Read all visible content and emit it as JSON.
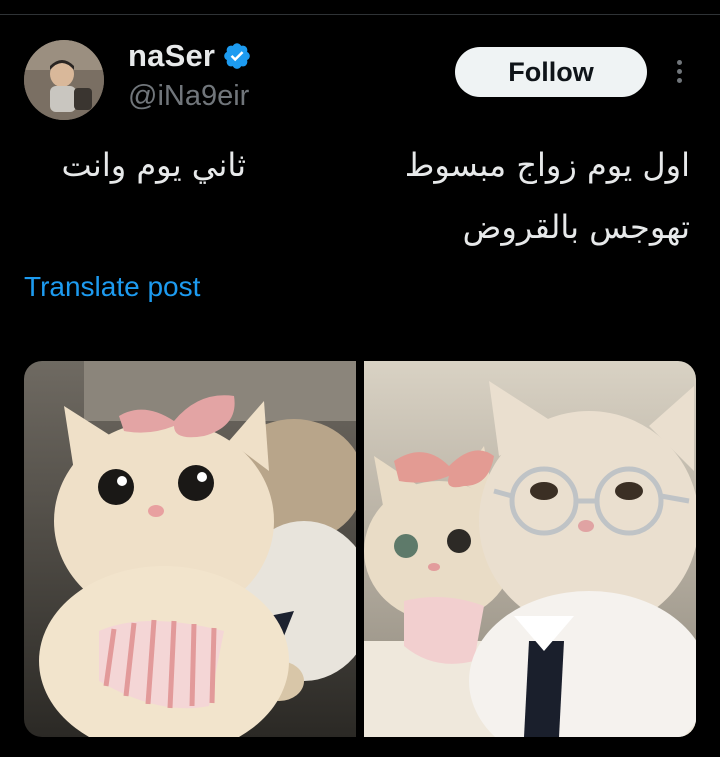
{
  "author": {
    "display_name": "naSer",
    "handle": "@iNa9eir",
    "verified": true,
    "verified_color": "#1d9bf0"
  },
  "actions": {
    "follow_label": "Follow",
    "more_icon": "more-vertical-icon"
  },
  "post": {
    "text_lines": [
      "اول يوم زواج مبسوط",
      "تهوجس بالقروض"
    ],
    "text_left": "ثاني يوم وانت",
    "translate_label": "Translate post"
  },
  "media": {
    "photos": [
      {
        "alt_icon": "cats-photo-1"
      },
      {
        "alt_icon": "cats-photo-2"
      }
    ]
  },
  "colors": {
    "background": "#000000",
    "text": "#e7e9ea",
    "muted": "#71767b",
    "link": "#1d9bf0",
    "button_bg": "#eff3f4"
  }
}
